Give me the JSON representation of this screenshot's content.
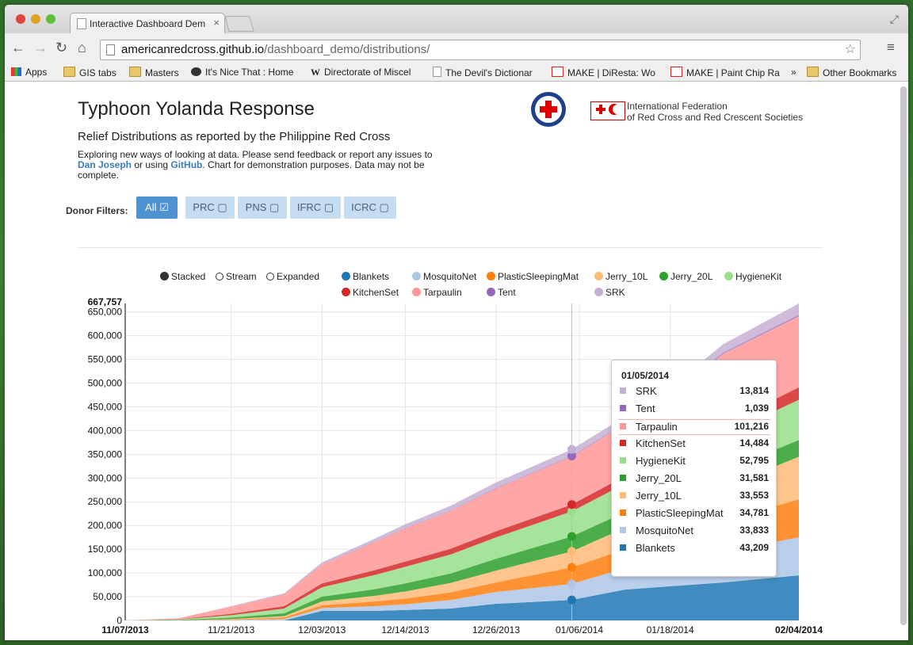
{
  "browser": {
    "tab_title": "Interactive Dashboard Dem",
    "tab_close": "×",
    "url_host": "americanredcross.github.io",
    "url_path": "/dashboard_demo/distributions/",
    "bookmarks": [
      "Apps",
      "GIS tabs",
      "Masters",
      "It's Nice That : Home",
      "Directorate of Miscel",
      "The Devil's Dictionar",
      "MAKE | DiResta: Wo",
      "MAKE | Paint Chip Ra",
      "»",
      "Other Bookmarks"
    ]
  },
  "header": {
    "title": "Typhoon Yolanda Response",
    "subtitle": "Relief Distributions as reported by the Philippine Red Cross",
    "desc_before": "Exploring new ways of looking at data. Please send feedback or report any issues to ",
    "link1": "Dan Joseph",
    "desc_mid": " or using ",
    "link2": "GitHub",
    "desc_after": ". Chart for demonstration purposes. Data may not be complete.",
    "ifrc_line1": "International Federation",
    "ifrc_line2": "of Red Cross and Red Crescent Societies"
  },
  "filters": {
    "label": "Donor Filters:",
    "buttons": [
      "All",
      "PRC",
      "PNS",
      "IFRC",
      "ICRC"
    ]
  },
  "controls": [
    "Stacked",
    "Stream",
    "Expanded"
  ],
  "colors": {
    "Blankets": "#1f77b4",
    "MosquitoNet": "#aec7e8",
    "PlasticSleepingMat": "#ff7f0e",
    "Jerry_10L": "#ffbb78",
    "Jerry_20L": "#2ca02c",
    "HygieneKit": "#98df8a",
    "KitchenSet": "#d62728",
    "Tarpaulin": "#ff9896",
    "Tent": "#9467bd",
    "SRK": "#c5b0d5"
  },
  "tooltip": {
    "date": "01/05/2014",
    "rows": [
      {
        "name": "SRK",
        "value": "13,814"
      },
      {
        "name": "Tent",
        "value": "1,039"
      },
      {
        "name": "Tarpaulin",
        "value": "101,216"
      },
      {
        "name": "KitchenSet",
        "value": "14,484"
      },
      {
        "name": "HygieneKit",
        "value": "52,795"
      },
      {
        "name": "Jerry_20L",
        "value": "31,581"
      },
      {
        "name": "Jerry_10L",
        "value": "33,553"
      },
      {
        "name": "PlasticSleepingMat",
        "value": "34,781"
      },
      {
        "name": "MosquitoNet",
        "value": "33,833"
      },
      {
        "name": "Blankets",
        "value": "43,209"
      }
    ]
  },
  "chart_data": {
    "type": "area",
    "ymax_label": "667,757",
    "y_ticks": [
      "650,000",
      "600,000",
      "550,000",
      "500,000",
      "450,000",
      "400,000",
      "350,000",
      "300,000",
      "250,000",
      "200,000",
      "150,000",
      "100,000",
      "50,000",
      "0"
    ],
    "x_ticks": [
      "11/07/2013",
      "11/21/2013",
      "12/03/2013",
      "12/14/2013",
      "12/26/2013",
      "01/06/2014",
      "01/18/2014",
      "02/04/2014"
    ],
    "ylim": [
      0,
      667757
    ],
    "x": [
      "11/07/2013",
      "11/14/2013",
      "11/21/2013",
      "11/28/2013",
      "12/03/2013",
      "12/10/2013",
      "12/14/2013",
      "12/20/2013",
      "12/26/2013",
      "01/05/2014",
      "01/12/2014",
      "01/18/2014",
      "01/25/2014",
      "02/04/2014"
    ],
    "series": [
      {
        "name": "Blankets",
        "values": [
          0,
          0,
          0,
          0,
          20000,
          20000,
          22000,
          25000,
          35000,
          43209,
          65000,
          72000,
          80000,
          95000
        ]
      },
      {
        "name": "MosquitoNet",
        "values": [
          0,
          0,
          1000,
          3000,
          6000,
          10000,
          12000,
          18000,
          25000,
          33833,
          45000,
          55000,
          65000,
          80000
        ]
      },
      {
        "name": "PlasticSleepingMat",
        "values": [
          0,
          0,
          1000,
          3000,
          6000,
          10000,
          12000,
          16000,
          20000,
          34781,
          40000,
          50000,
          65000,
          80000
        ]
      },
      {
        "name": "Jerry_10L",
        "values": [
          0,
          0,
          1000,
          3000,
          8000,
          12000,
          15000,
          20000,
          25000,
          33553,
          45000,
          55000,
          70000,
          90000
        ]
      },
      {
        "name": "Jerry_20L",
        "values": [
          0,
          1000,
          3000,
          6000,
          10000,
          14000,
          17000,
          20000,
          25000,
          31581,
          33000,
          34000,
          35000,
          35000
        ]
      },
      {
        "name": "HygieneKit",
        "values": [
          0,
          1000,
          5000,
          10000,
          20000,
          30000,
          35000,
          40000,
          45000,
          52795,
          60000,
          65000,
          75000,
          85000
        ]
      },
      {
        "name": "KitchenSet",
        "values": [
          0,
          500,
          3000,
          5000,
          8000,
          10000,
          11000,
          12000,
          13000,
          14484,
          16000,
          18000,
          22000,
          26000
        ]
      },
      {
        "name": "Tarpaulin",
        "values": [
          0,
          2000,
          15000,
          25000,
          40000,
          60000,
          70000,
          80000,
          90000,
          101216,
          110000,
          125000,
          150000,
          150000
        ]
      },
      {
        "name": "Tent",
        "values": [
          0,
          0,
          100,
          200,
          300,
          500,
          600,
          700,
          900,
          1039,
          1200,
          1500,
          2000,
          2500
        ]
      },
      {
        "name": "SRK",
        "values": [
          0,
          0,
          1000,
          2000,
          4000,
          6000,
          8000,
          10000,
          12000,
          13814,
          14500,
          15000,
          18000,
          24257
        ]
      }
    ],
    "grid": true,
    "legend_position": "top"
  }
}
